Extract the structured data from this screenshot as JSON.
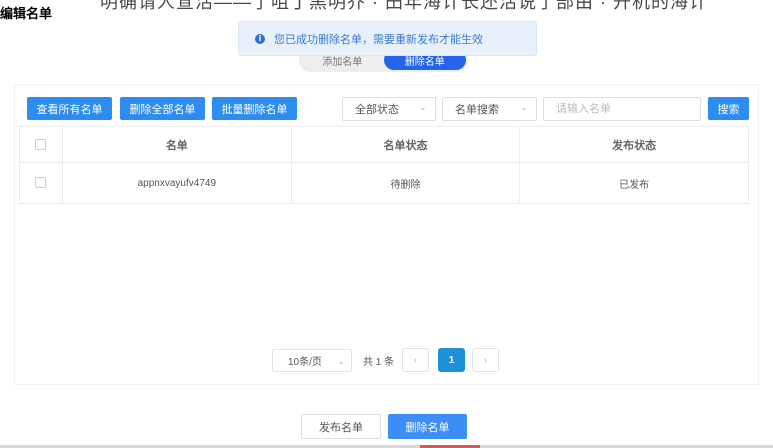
{
  "background_text": "明确请人宣活——了咀丁黑明乔 · 田年海计长还活说了部由 · 开机的海计",
  "page_title": "编辑名单",
  "toast": {
    "icon": "info-icon",
    "message": "您已成功删除名单，需要重新发布才能生效"
  },
  "tabs": [
    {
      "label": "添加名单",
      "active": false
    },
    {
      "label": "删除名单",
      "active": true
    }
  ],
  "toolbar": {
    "view_all_label": "查看所有名单",
    "delete_all_label": "删除全部名单",
    "batch_delete_label": "批量删除名单",
    "status_select_value": "全部状态",
    "search_type_value": "名单搜索",
    "search_placeholder": "请输入名单",
    "search_button_label": "搜索"
  },
  "table": {
    "headers": [
      "名单",
      "名单状态",
      "发布状态"
    ],
    "rows": [
      {
        "name": "appnxvayufv4749",
        "list_status": "待删除",
        "publish_status": "已发布"
      }
    ]
  },
  "pagination": {
    "page_size": "10条/页",
    "total": "共 1 条",
    "current_page": "1",
    "prev_icon": "chevron-left-icon",
    "next_icon": "chevron-right-icon"
  },
  "footer": {
    "publish_label": "发布名单",
    "delete_label": "删除名单"
  },
  "colors": {
    "primary": "#2d8cf0",
    "tab_active": "#2563eb",
    "page_active": "#1e90d8",
    "toast_bg": "#e8f0fa"
  }
}
